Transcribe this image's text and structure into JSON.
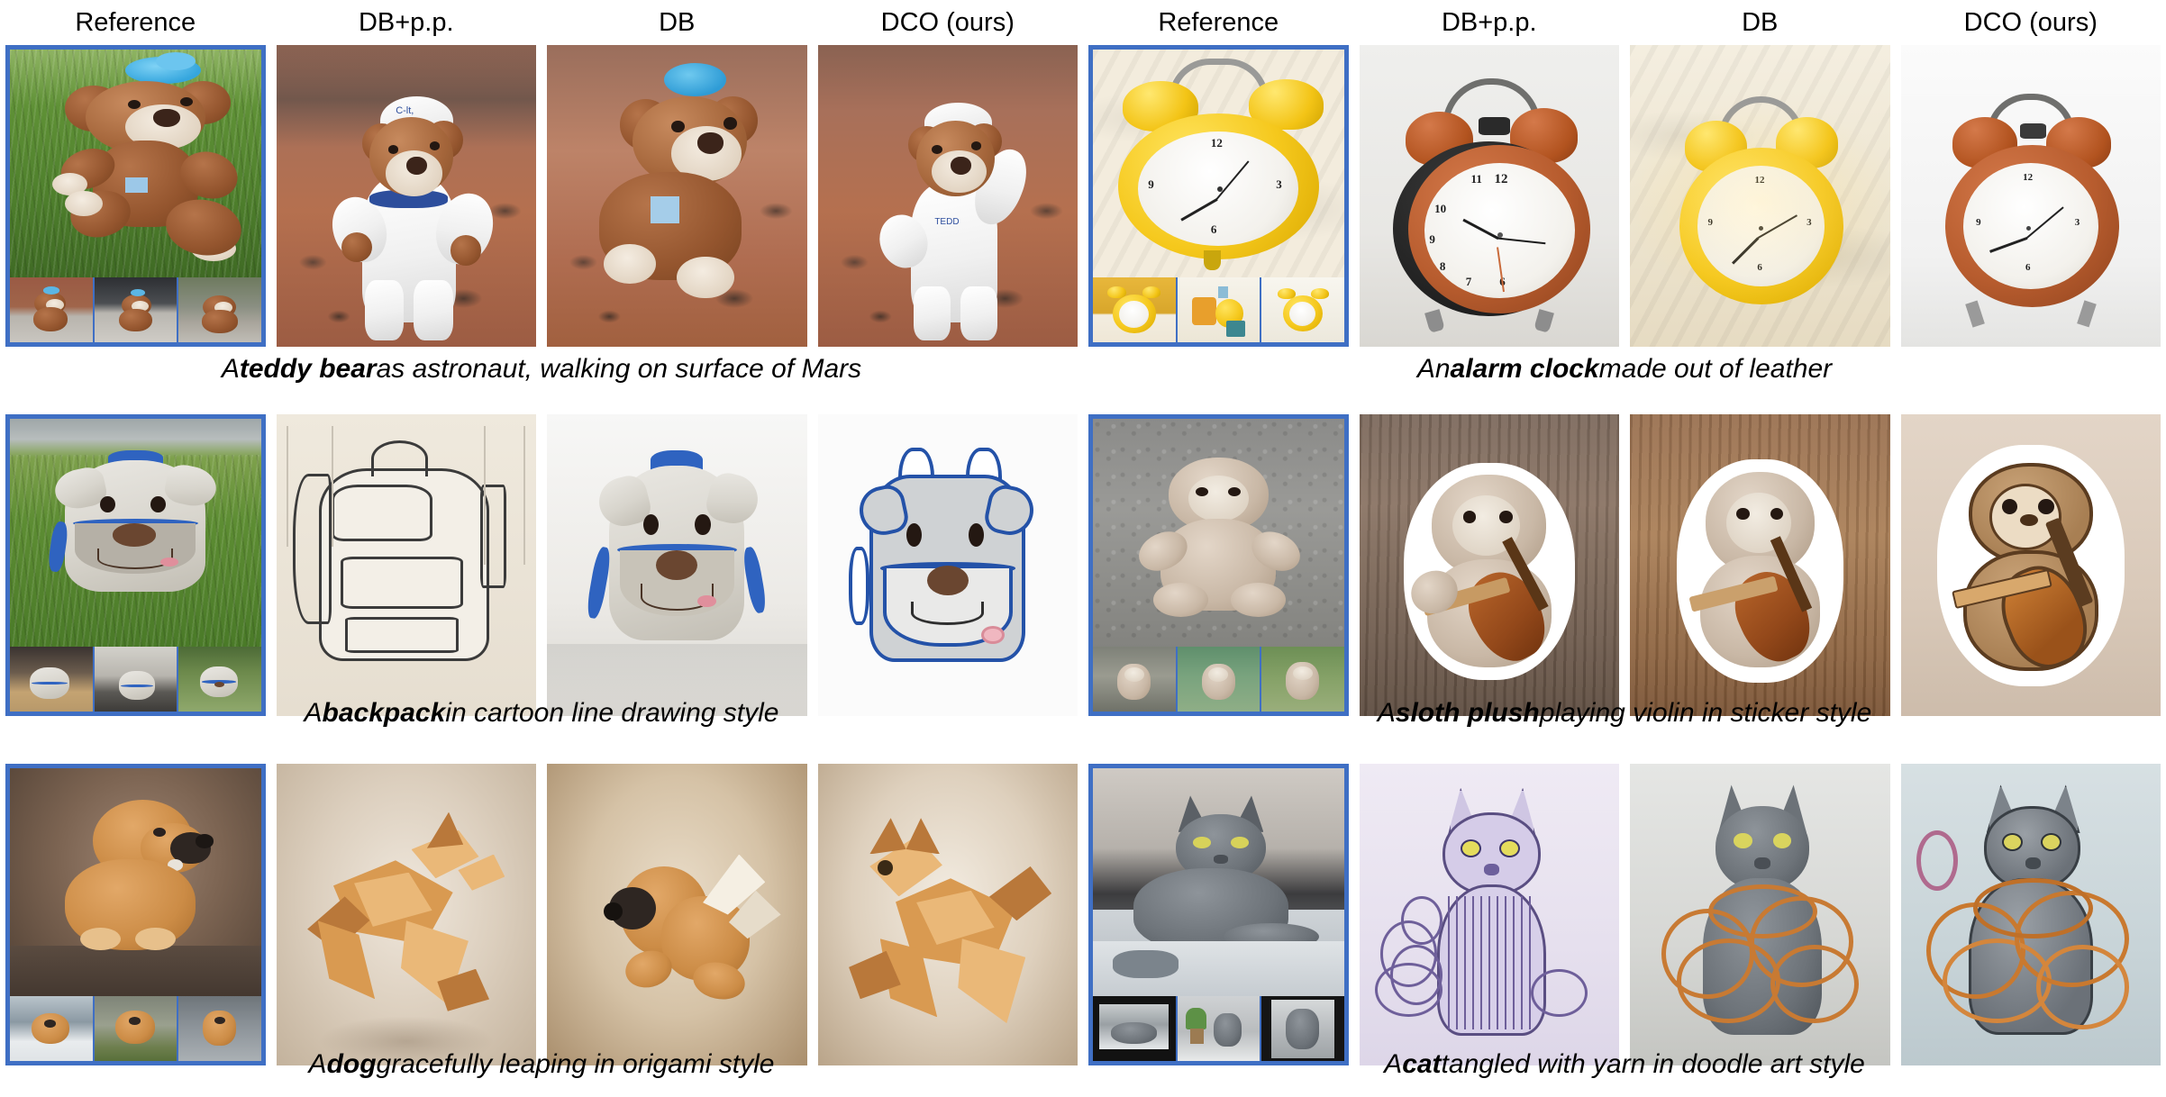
{
  "figure": {
    "columns": [
      "Reference",
      "DB+p.p.",
      "DB",
      "DCO (ours)",
      "Reference",
      "DB+p.p.",
      "DB",
      "DCO (ours)"
    ],
    "column_groups": [
      {
        "id": "left",
        "headers": [
          "Reference",
          "DB+p.p.",
          "DB",
          "DCO (ours)"
        ]
      },
      {
        "id": "right",
        "headers": [
          "Reference",
          "DB+p.p.",
          "DB",
          "DCO (ours)"
        ]
      }
    ],
    "reference_border_color": "#3f6fc4",
    "background_color": "#ffffff"
  },
  "rows": [
    {
      "index": 1,
      "left": {
        "subject": "teddy bear",
        "caption_prefix": "A ",
        "caption_bold": "teddy bear",
        "caption_suffix": " as astronaut, walking on surface of Mars",
        "caption_full": "A teddy bear as astronaut, walking on surface of Mars",
        "cells": [
          {
            "column": "Reference",
            "alt": "brown teddy bear with blue bow sitting in grass",
            "thumbs": 3
          },
          {
            "column": "DB+p.p.",
            "alt": "teddy bear in white astronaut suit standing on red Mars soil"
          },
          {
            "column": "DB",
            "alt": "teddy bear with blue bow lying on red Mars sand"
          },
          {
            "column": "DCO (ours)",
            "alt": "teddy bear in astronaut suit waving on Mars surface"
          }
        ]
      },
      "right": {
        "subject": "alarm clock",
        "caption_prefix": "An ",
        "caption_bold": "alarm clock",
        "caption_suffix": " made out of leather",
        "caption_full": "An alarm clock made out of leather",
        "cells": [
          {
            "column": "Reference",
            "alt": "yellow twin-bell alarm clock on white bedsheet",
            "thumbs": 3
          },
          {
            "column": "DB+p.p.",
            "alt": "brown leather-toned twin-bell alarm clock on grey backdrop"
          },
          {
            "column": "DB",
            "alt": "yellow twin-bell alarm clock on cream bedding"
          },
          {
            "column": "DCO (ours)",
            "alt": "brown leather twin-bell alarm clock on light grey surface"
          }
        ]
      }
    },
    {
      "index": 2,
      "left": {
        "subject": "backpack",
        "caption_prefix": "A ",
        "caption_bold": "backpack",
        "caption_suffix": " in cartoon line drawing style",
        "caption_full": "A backpack in cartoon line drawing style",
        "cells": [
          {
            "column": "Reference",
            "alt": "grey dog-face children's backpack on grass",
            "thumbs": 3
          },
          {
            "column": "DB+p.p.",
            "alt": "line-drawing sketch of a plain backpack"
          },
          {
            "column": "DB",
            "alt": "photo of grey dog-face backpack on white background"
          },
          {
            "column": "DCO (ours)",
            "alt": "cartoon line drawing of dog-face backpack"
          }
        ]
      },
      "right": {
        "subject": "sloth plush",
        "caption_prefix": "A ",
        "caption_bold": "sloth plush",
        "caption_suffix": " playing violin in sticker style",
        "caption_full": "A sloth plush playing violin in sticker style",
        "cells": [
          {
            "column": "Reference",
            "alt": "beige sloth plush toy sitting on asphalt",
            "thumbs": 3
          },
          {
            "column": "DB+p.p.",
            "alt": "sloth plush holding violin sticker on grey wood"
          },
          {
            "column": "DB",
            "alt": "sloth plush with violin on brown wood plank"
          },
          {
            "column": "DCO (ours)",
            "alt": "cartoon sticker of sloth playing violin"
          }
        ]
      }
    },
    {
      "index": 3,
      "left": {
        "subject": "dog",
        "caption_prefix": "A ",
        "caption_bold": "dog",
        "caption_suffix": " gracefully leaping in origami style",
        "caption_full": "A dog gracefully leaping in origami style",
        "cells": [
          {
            "column": "Reference",
            "alt": "chow chow dog lying down, brown studio backdrop",
            "thumbs": 3
          },
          {
            "column": "DB+p.p.",
            "alt": "origami paper dog leaping"
          },
          {
            "column": "DB",
            "alt": "chow chow dog leaping with paper wings"
          },
          {
            "column": "DCO (ours)",
            "alt": "origami chow chow dog leaping"
          }
        ]
      },
      "right": {
        "subject": "cat",
        "caption_prefix": "A ",
        "caption_bold": "cat",
        "caption_suffix": " tangled with yarn in doodle art style",
        "caption_full": "A cat tangled with yarn in doodle art style",
        "cells": [
          {
            "column": "Reference",
            "alt": "grey russian blue cat lying on bed",
            "thumbs": 3
          },
          {
            "column": "DB+p.p.",
            "alt": "doodle line-art cat with purple yarn"
          },
          {
            "column": "DB",
            "alt": "grey cat tangled in orange yarn, photo"
          },
          {
            "column": "DCO (ours)",
            "alt": "doodle style grey cat wrapped in orange yarn"
          }
        ]
      }
    }
  ]
}
